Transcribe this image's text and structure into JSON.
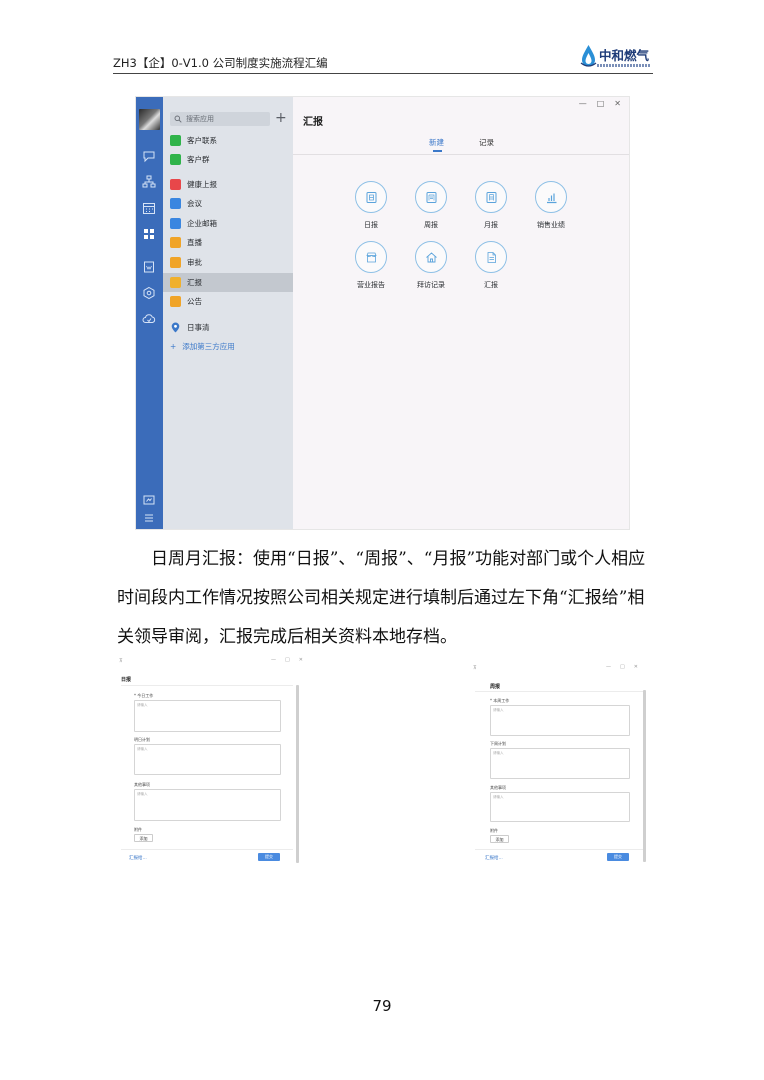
{
  "header": {
    "title": "ZH3【企】0-V1.0 公司制度实施流程汇编",
    "logo_text": "中和燃气"
  },
  "app": {
    "search_placeholder": "搜索应用",
    "add_symbol": "+",
    "window_controls": [
      "—",
      "□",
      "✕"
    ],
    "sidebar": {
      "items": [
        {
          "label": "客户联系",
          "color": "#2fb34a"
        },
        {
          "label": "客户群",
          "color": "#2fb34a"
        },
        {
          "label": "健康上报",
          "color": "#e8474a"
        },
        {
          "label": "会议",
          "color": "#3a86e0"
        },
        {
          "label": "企业邮箱",
          "color": "#3a86e0"
        },
        {
          "label": "直播",
          "color": "#f0a428"
        },
        {
          "label": "审批",
          "color": "#f0a428"
        },
        {
          "label": "汇报",
          "color": "#f0b02c"
        },
        {
          "label": "公告",
          "color": "#f0a428"
        }
      ],
      "schedule_label": "日事清",
      "add_label": "添加第三方应用"
    },
    "main": {
      "title": "汇报",
      "tabs": [
        {
          "label": "新建",
          "active": true
        },
        {
          "label": "记录",
          "active": false
        }
      ],
      "tiles": [
        {
          "label": "日报",
          "icon": "day-icon"
        },
        {
          "label": "周报",
          "icon": "week-icon"
        },
        {
          "label": "月报",
          "icon": "month-icon"
        },
        {
          "label": "销售业绩",
          "icon": "chart-icon"
        },
        {
          "label": "营业报告",
          "icon": "store-icon"
        },
        {
          "label": "拜访记录",
          "icon": "home-icon"
        },
        {
          "label": "汇报",
          "icon": "report-icon"
        }
      ]
    },
    "accent_color": "#3b78c9"
  },
  "paragraph": "日周月汇报：使用“日报”、“周报”、“月报”功能对部门或个人相应时间段内工作情况按照公司相关规定进行填制后通过左下角“汇报给”相关领导审阅，汇报完成后相关资料本地存档。",
  "mini_left": {
    "title": "日报",
    "field1_label": "* 今日工作",
    "field2_label": "明日计划",
    "field3_label": "其他事项",
    "placeholder": "请输入",
    "attachment_label": "附件",
    "add_button": "添加",
    "footer_link": "汇报给...",
    "submit_button": "提交"
  },
  "mini_right": {
    "title": "周报",
    "field1_label": "* 本周工作",
    "field2_label": "下周计划",
    "field3_label": "其他事项",
    "placeholder": "请输入",
    "attachment_label": "附件",
    "add_button": "添加",
    "footer_link": "汇报给...",
    "submit_button": "提交"
  },
  "page_number": "79"
}
